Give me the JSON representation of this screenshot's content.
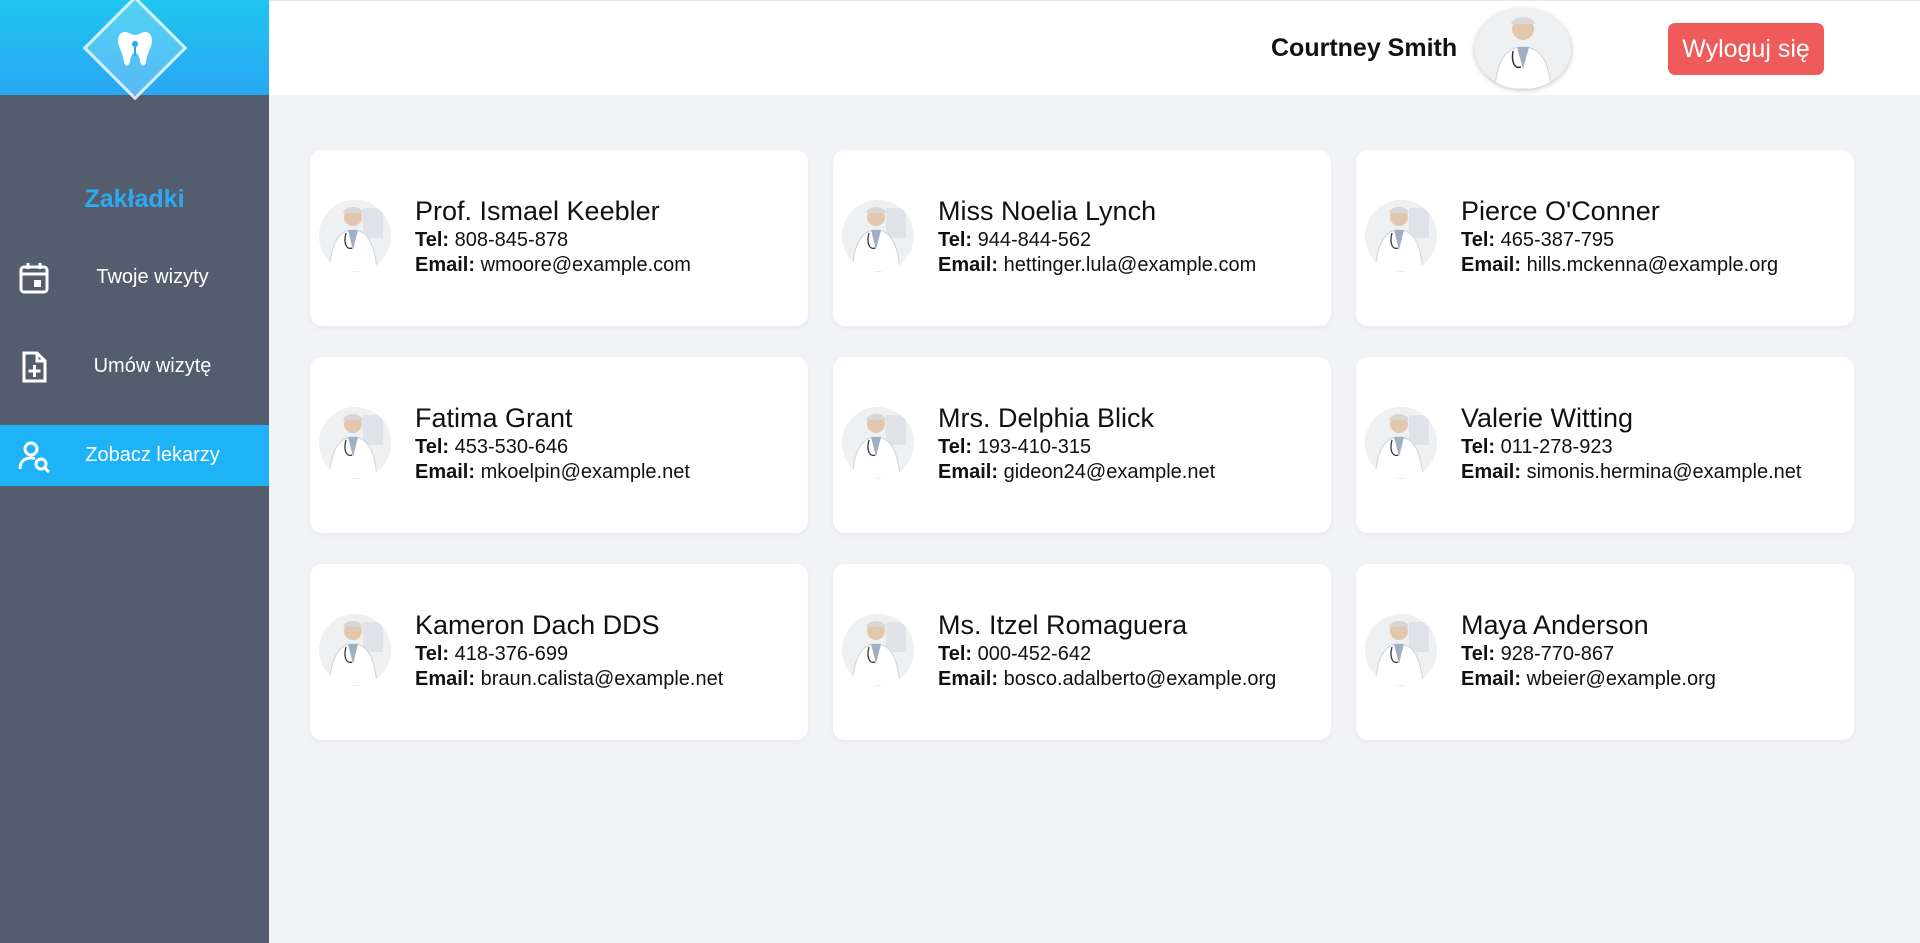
{
  "sidebar": {
    "heading": "Zakładki",
    "items": [
      {
        "label": "Twoje wizyty",
        "icon": "calendar-icon"
      },
      {
        "label": "Umów wizytę",
        "icon": "file-add-icon"
      },
      {
        "label": "Zobacz lekarzy",
        "icon": "user-search-icon"
      }
    ],
    "active_index": 2
  },
  "header": {
    "user_name": "Courtney Smith",
    "logout_label": "Wyloguj się"
  },
  "labels": {
    "tel": "Tel:",
    "email": "Email:"
  },
  "doctors": [
    {
      "name": "Prof. Ismael Keebler",
      "tel": "808-845-878",
      "email": "wmoore@example.com"
    },
    {
      "name": "Miss Noelia Lynch",
      "tel": "944-844-562",
      "email": "hettinger.lula@example.com"
    },
    {
      "name": "Pierce O'Conner",
      "tel": "465-387-795",
      "email": "hills.mckenna@example.org"
    },
    {
      "name": "Fatima Grant",
      "tel": "453-530-646",
      "email": "mkoelpin@example.net"
    },
    {
      "name": "Mrs. Delphia Blick",
      "tel": "193-410-315",
      "email": "gideon24@example.net"
    },
    {
      "name": "Valerie Witting",
      "tel": "011-278-923",
      "email": "simonis.hermina@example.net"
    },
    {
      "name": "Kameron Dach DDS",
      "tel": "418-376-699",
      "email": "braun.calista@example.net"
    },
    {
      "name": "Ms. Itzel Romaguera",
      "tel": "000-452-642",
      "email": "bosco.adalberto@example.org"
    },
    {
      "name": "Maya Anderson",
      "tel": "928-770-867",
      "email": "wbeier@example.org"
    }
  ],
  "colors": {
    "sidebar_bg": "#545d6e",
    "accent": "#1eb3f7",
    "heading": "#2ea9ef",
    "logout": "#ef5b5b",
    "content_bg": "#f2f3f6"
  }
}
